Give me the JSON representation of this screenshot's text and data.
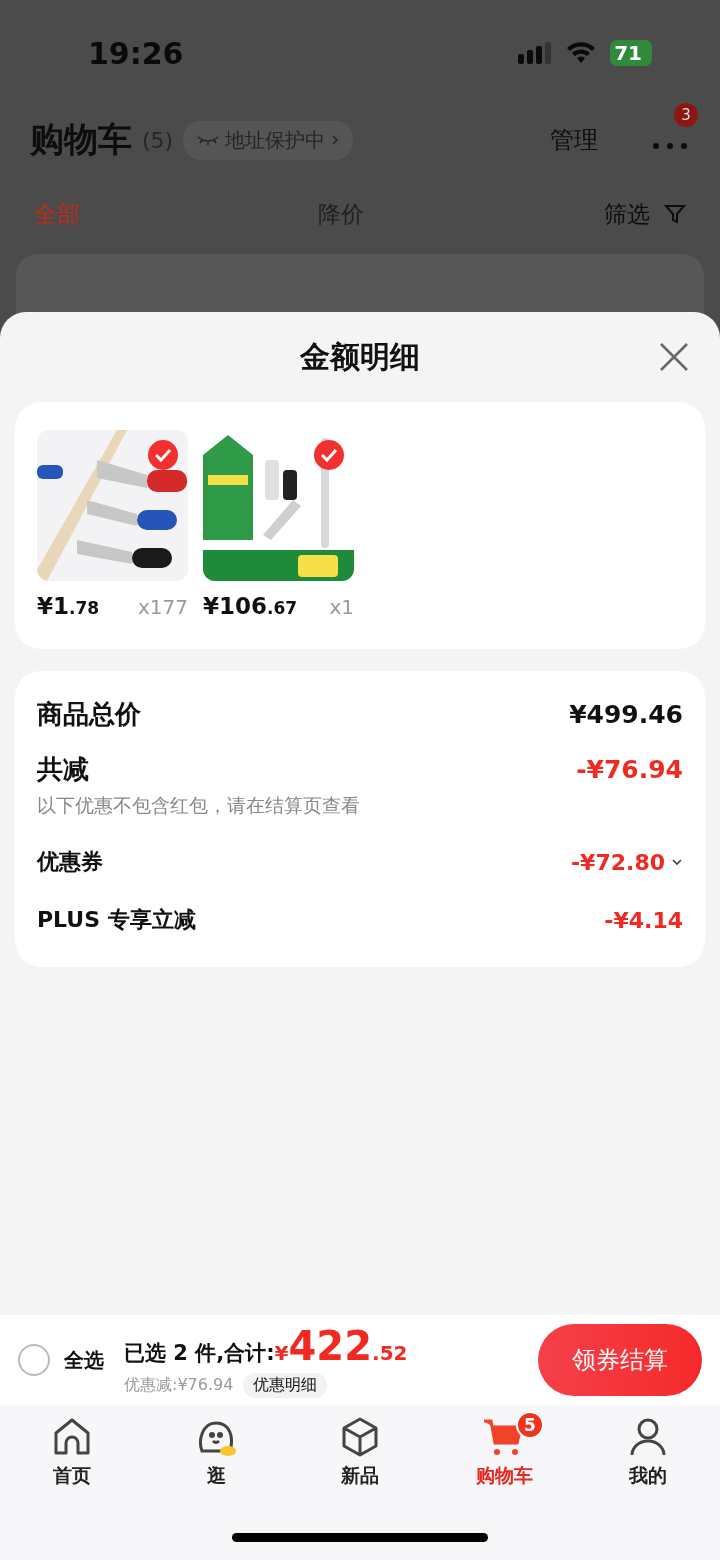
{
  "status_bar": {
    "time": "19:26",
    "battery": "71"
  },
  "header": {
    "title": "购物车",
    "count": "(5)",
    "address": "地址保护中",
    "manage": "管理",
    "more_badge": "3"
  },
  "filter_tabs": [
    {
      "label": "全部",
      "selected": true
    },
    {
      "label": "降价",
      "selected": false
    }
  ],
  "filter": "筛选",
  "sheet": {
    "title": "金额明细",
    "products": [
      {
        "kind": "scissors",
        "price": "¥1.78",
        "qty": "x177",
        "selected": true
      },
      {
        "kind": "vacuum",
        "price": "¥106.67",
        "qty": "x1",
        "selected": true
      }
    ],
    "summary": [
      {
        "kind": "total",
        "label": "商品总价",
        "value": "¥499.46"
      },
      {
        "kind": "reduction",
        "label": "共减",
        "value": "-¥76.94",
        "note": "以下优惠不包含红包，请在结算页查看"
      },
      {
        "kind": "detail",
        "label": "优惠券",
        "value": "-¥72.80",
        "expandable": true
      },
      {
        "kind": "detail",
        "label": "PLUS 专享立减",
        "value": "-¥4.14",
        "expandable": false
      }
    ]
  },
  "bottom_bar": {
    "select_all": {
      "label": "全选",
      "checked": false
    },
    "selected_text": "已选 2 件,合计:",
    "total": "¥422.52",
    "discount": "优惠减:¥76.94",
    "detail_button": "优惠明细",
    "checkout": "领券结算"
  },
  "tab_bar": [
    {
      "kind": "home",
      "label": "首页",
      "selected": false
    },
    {
      "kind": "browse",
      "label": "逛",
      "selected": false
    },
    {
      "kind": "new",
      "label": "新品",
      "selected": false
    },
    {
      "kind": "cart",
      "label": "购物车",
      "selected": true,
      "badge": "5"
    },
    {
      "kind": "me",
      "label": "我的",
      "selected": false
    }
  ]
}
